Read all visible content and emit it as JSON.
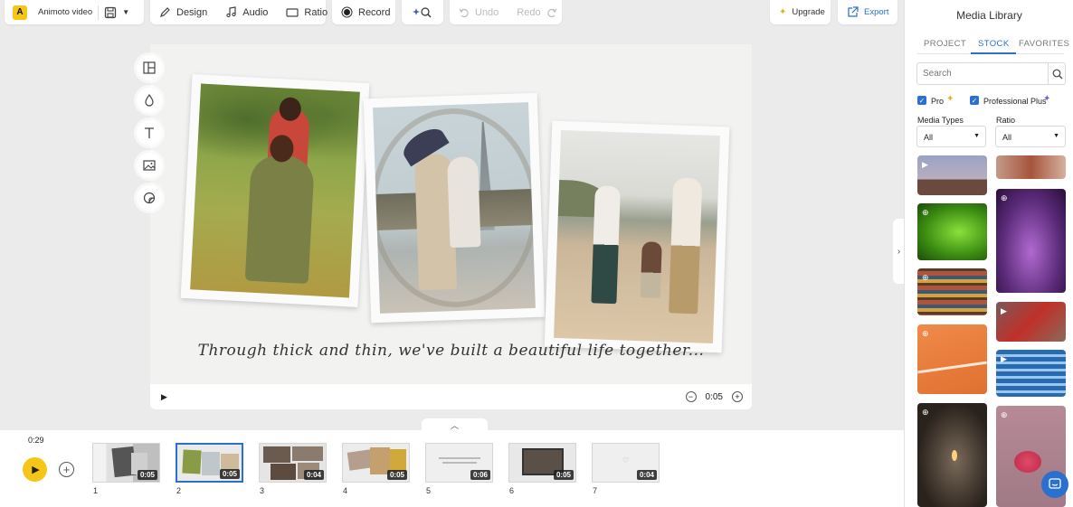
{
  "toolbar": {
    "project_name": "Animoto video",
    "logo_letter": "A",
    "design_label": "Design",
    "audio_label": "Audio",
    "ratio_label": "Ratio",
    "record_label": "Record",
    "undo_label": "Undo",
    "redo_label": "Redo",
    "upgrade_label": "Upgrade",
    "export_label": "Export"
  },
  "canvas": {
    "caption": "Through thick and thin, we've built a beautiful life together...",
    "current_time": "0:05"
  },
  "timeline": {
    "total_time": "0:29",
    "scenes": [
      {
        "num": "1",
        "duration": "0:05"
      },
      {
        "num": "2",
        "duration": "0:05"
      },
      {
        "num": "3",
        "duration": "0:04"
      },
      {
        "num": "4",
        "duration": "0:05"
      },
      {
        "num": "5",
        "duration": "0:06"
      },
      {
        "num": "6",
        "duration": "0:05"
      },
      {
        "num": "7",
        "duration": "0:04"
      }
    ]
  },
  "library": {
    "title": "Media Library",
    "tabs": [
      "PROJECT",
      "STOCK",
      "FAVORITES"
    ],
    "search_placeholder": "Search",
    "checks": [
      "Pro",
      "Professional Plus"
    ],
    "media_types_label": "Media Types",
    "media_types_value": "All",
    "ratio_label": "Ratio",
    "ratio_value": "All"
  },
  "colors": {
    "accent": "#2b6fcf",
    "brand_yellow": "#f5c518"
  }
}
